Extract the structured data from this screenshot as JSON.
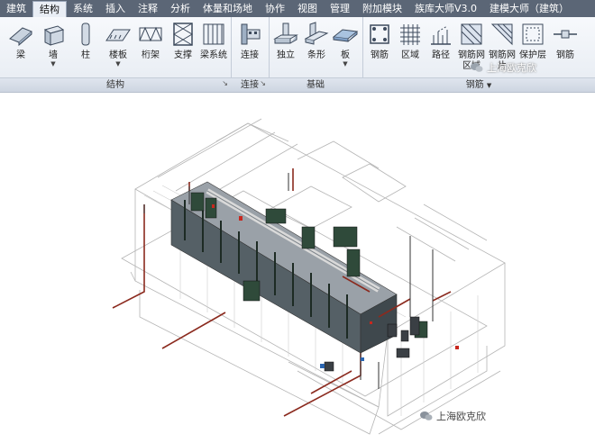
{
  "tabs": [
    "建筑",
    "结构",
    "系统",
    "插入",
    "注释",
    "分析",
    "体量和场地",
    "协作",
    "视图",
    "管理",
    "附加模块",
    "族库大师V3.0",
    "建模大师（建筑）"
  ],
  "active_tab": "结构",
  "groups": {
    "structure": {
      "label": "结构",
      "tools": [
        "梁",
        "墙",
        "柱",
        "楼板",
        "桁架",
        "支撑",
        "梁系统"
      ]
    },
    "connection": {
      "label": "连接",
      "tools": [
        "连接"
      ]
    },
    "foundation": {
      "label": "基础",
      "tools": [
        "独立",
        "条形",
        "板"
      ]
    },
    "rebar": {
      "label": "钢筋",
      "tools": [
        "钢筋",
        "区域",
        "路径",
        "钢筋网区域",
        "钢筋网片",
        "保护层",
        "钢筋"
      ]
    }
  },
  "watermark_top": "上海欧克欣",
  "watermark_bottom": "上海欧克欣",
  "colors": {
    "tabbar": "#5b6676",
    "ribbon": "#eef2f7",
    "pipe": "#8b2a1e",
    "equipment": "#2f4a3a"
  }
}
